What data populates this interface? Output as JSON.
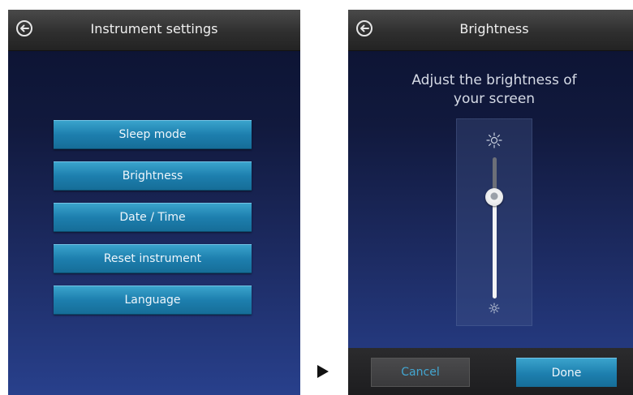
{
  "left_screen": {
    "title": "Instrument settings",
    "menu": [
      {
        "label": "Sleep mode"
      },
      {
        "label": "Brightness"
      },
      {
        "label": "Date / Time"
      },
      {
        "label": "Reset instrument"
      },
      {
        "label": "Language"
      }
    ]
  },
  "right_screen": {
    "title": "Brightness",
    "prompt_line1": "Adjust the brightness of",
    "prompt_line2": "your screen",
    "brightness_level": 0.72,
    "cancel_label": "Cancel",
    "done_label": "Done"
  },
  "icons": {
    "back": "back-arrow-circle-icon",
    "bright": "sun-bright-icon",
    "dim": "sun-dim-icon",
    "flow": "arrow-right-triangle-icon"
  },
  "colors": {
    "accent_button": "#1d7fae",
    "cancel_text": "#43a6d1"
  }
}
